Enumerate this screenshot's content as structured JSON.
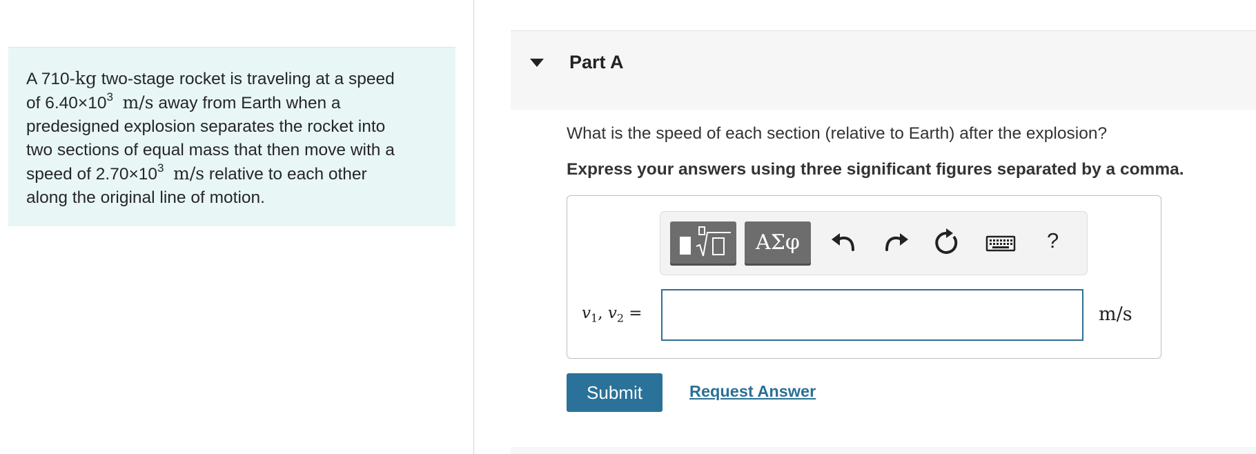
{
  "problem": {
    "t1": "A 710-",
    "u_kg": "kg",
    "t2": " two-stage rocket is traveling at a speed",
    "t3": "of 6.40×10",
    "exp1": "3",
    "u_ms1": "m/s",
    "t4": " away from Earth when a",
    "t5": "predesigned explosion separates the rocket into",
    "t6": "two sections of equal mass that then move with a",
    "t7": "speed of 2.70×10",
    "exp2": "3",
    "u_ms2": "m/s",
    "t8": " relative to each other",
    "t9": "along the original line of motion."
  },
  "part": {
    "title": "Part A"
  },
  "question": {
    "text": "What is the speed of each section (relative to Earth) after the explosion?",
    "instruction": "Express your answers using three significant figures separated by a comma."
  },
  "toolbar": {
    "symbols_label": "ΑΣφ",
    "help_label": "?"
  },
  "answer": {
    "v": "v",
    "sub1": "1",
    "sep": ", ",
    "sub2": "2",
    "eq": " =",
    "value": "",
    "units": "m/s"
  },
  "actions": {
    "submit_label": "Submit",
    "request_label": "Request Answer"
  },
  "colors": {
    "problem_bg": "#e8f6f6",
    "submit_bg": "#2a7299",
    "link": "#2a6f96",
    "input_border": "#2e6f91"
  }
}
